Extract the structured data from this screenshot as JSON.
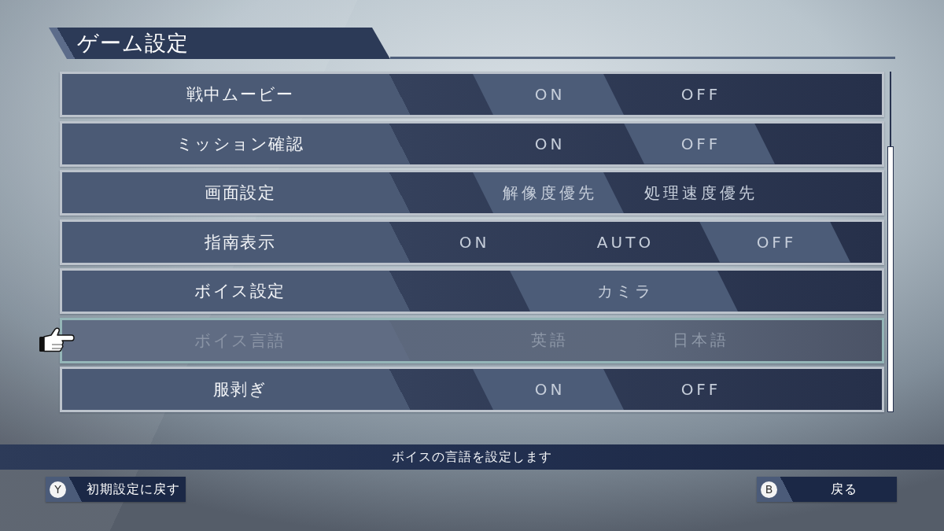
{
  "title": "ゲーム設定",
  "settings": [
    {
      "label": "戦中ムービー",
      "disabled": false,
      "focused": false,
      "options": [
        {
          "label": "ON",
          "selected": true
        },
        {
          "label": "OFF",
          "selected": false
        }
      ]
    },
    {
      "label": "ミッション確認",
      "disabled": false,
      "focused": false,
      "options": [
        {
          "label": "ON",
          "selected": false
        },
        {
          "label": "OFF",
          "selected": true
        }
      ]
    },
    {
      "label": "画面設定",
      "disabled": false,
      "focused": false,
      "options": [
        {
          "label": "解像度優先",
          "selected": true
        },
        {
          "label": "処理速度優先",
          "selected": false
        }
      ]
    },
    {
      "label": "指南表示",
      "disabled": false,
      "focused": false,
      "options": [
        {
          "label": "ON",
          "selected": false
        },
        {
          "label": "AUTO",
          "selected": false
        },
        {
          "label": "OFF",
          "selected": true
        }
      ]
    },
    {
      "label": "ボイス設定",
      "disabled": false,
      "focused": false,
      "options": [
        {
          "label": "カミラ",
          "selected": true
        }
      ]
    },
    {
      "label": "ボイス言語",
      "disabled": true,
      "focused": true,
      "options": [
        {
          "label": "英語",
          "selected": false
        },
        {
          "label": "日本語",
          "selected": false
        }
      ]
    },
    {
      "label": "服剥ぎ",
      "disabled": false,
      "focused": false,
      "options": [
        {
          "label": "ON",
          "selected": true
        },
        {
          "label": "OFF",
          "selected": false
        }
      ]
    }
  ],
  "help_text": "ボイスの言語を設定します",
  "buttons": [
    {
      "key": "Y",
      "label": "初期設定に戻す"
    },
    {
      "key": "B",
      "label": "戻る"
    }
  ]
}
